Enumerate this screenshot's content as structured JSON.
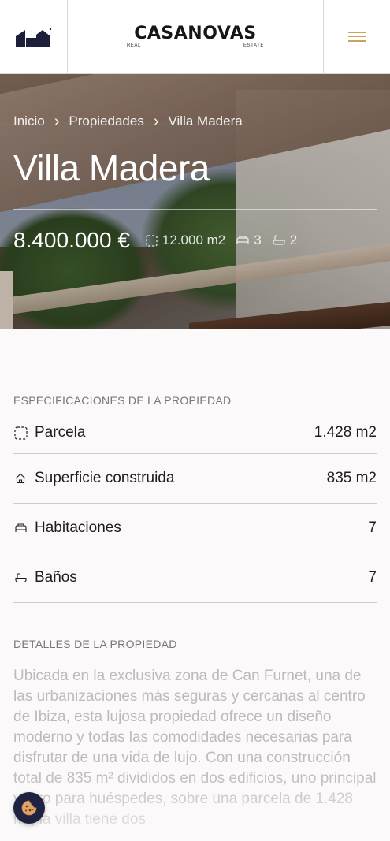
{
  "header": {
    "logo_icon": "casanovas-mark-icon",
    "brand_name": "CASANOVAS",
    "brand_sub_left": "REAL",
    "brand_sub_right": "ESTATE",
    "menu_icon": "hamburger-menu-icon"
  },
  "hero": {
    "breadcrumb": [
      "Inicio",
      "Propiedades",
      "Villa Madera"
    ],
    "title": "Villa Madera",
    "price": "8.400.000 €",
    "area": "12.000 m2",
    "bedrooms": "3",
    "bathrooms": "2"
  },
  "specs": {
    "heading": "ESPECIFICACIONES DE LA PROPIEDAD",
    "items": [
      {
        "label": "Parcela",
        "value": "1.428 m2",
        "icon": "plot-icon"
      },
      {
        "label": "Superficie construida",
        "value": "835 m2",
        "icon": "house-icon"
      },
      {
        "label": "Habitaciones",
        "value": "7",
        "icon": "bed-icon"
      },
      {
        "label": "Baños",
        "value": "7",
        "icon": "bathtub-icon"
      }
    ]
  },
  "details": {
    "heading": "DETALLES DE LA PROPIEDAD",
    "text": "Ubicada en la exclusiva zona de Can Furnet, una de las urbanizaciones más seguras y cercanas al centro de Ibiza, esta lujosa propiedad ofrece un diseño moderno y todas las comodidades necesarias para disfrutar de una vida de lujo. Con una construcción total de 835 m² divididos en dos edificios, uno principal y otro para huéspedes, sobre una parcela de 1.428 m², la villa tiene dos"
  },
  "cookie": {
    "icon": "cookie-icon"
  },
  "colors": {
    "accent": "#c9a557",
    "cookie_bg": "#1f2240"
  }
}
